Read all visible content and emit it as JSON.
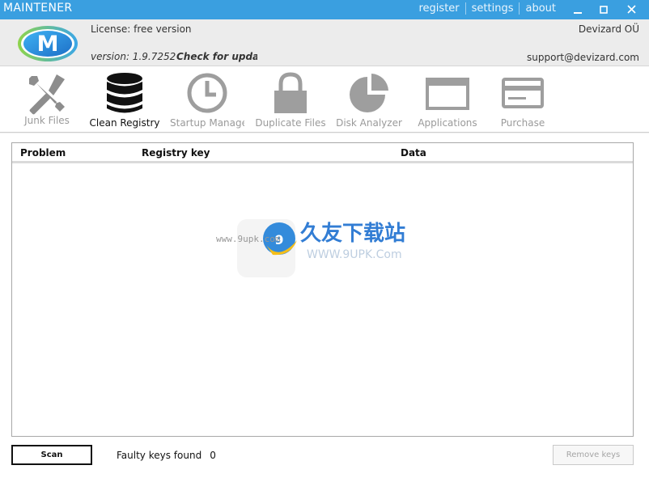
{
  "window": {
    "title": "MAINTENER",
    "links": [
      "register",
      "settings",
      "about"
    ],
    "controls": {
      "minimize": "▁",
      "maximize": "▢",
      "close": "✕"
    }
  },
  "header": {
    "license": "License: free version",
    "version": "version: 1.9.7252",
    "check_updates": "Check for updates",
    "company": "Devizard OÜ",
    "support": "support@devizard.com",
    "logo_letter": "M"
  },
  "toolbar": {
    "items": [
      {
        "label": "Junk Files",
        "icon": "tools-icon",
        "active": false
      },
      {
        "label": "Clean Registry",
        "icon": "database-icon",
        "active": true
      },
      {
        "label": "Startup Manager",
        "icon": "clock-icon",
        "active": false
      },
      {
        "label": "Duplicate Files",
        "icon": "lock-icon",
        "active": false
      },
      {
        "label": "Disk Analyzer",
        "icon": "pie-chart-icon",
        "active": false
      },
      {
        "label": "Applications",
        "icon": "window-icon",
        "active": false
      },
      {
        "label": "Purchase",
        "icon": "credit-card-icon",
        "active": false
      }
    ]
  },
  "table": {
    "columns": [
      "Problem",
      "Registry key",
      "Data"
    ],
    "rows": []
  },
  "watermark": {
    "text_cn": "久友下载站",
    "url_left": "www.9upk.com",
    "url_right": "WWW.9UPK.Com"
  },
  "footer": {
    "scan_label": "Scan",
    "faulty_label": "Faulty keys found",
    "faulty_count": "0",
    "remove_label": "Remove keys"
  },
  "colors": {
    "titlebar": "#3a9fe0",
    "icon_active": "#111111",
    "icon_inactive": "#9e9e9e"
  }
}
